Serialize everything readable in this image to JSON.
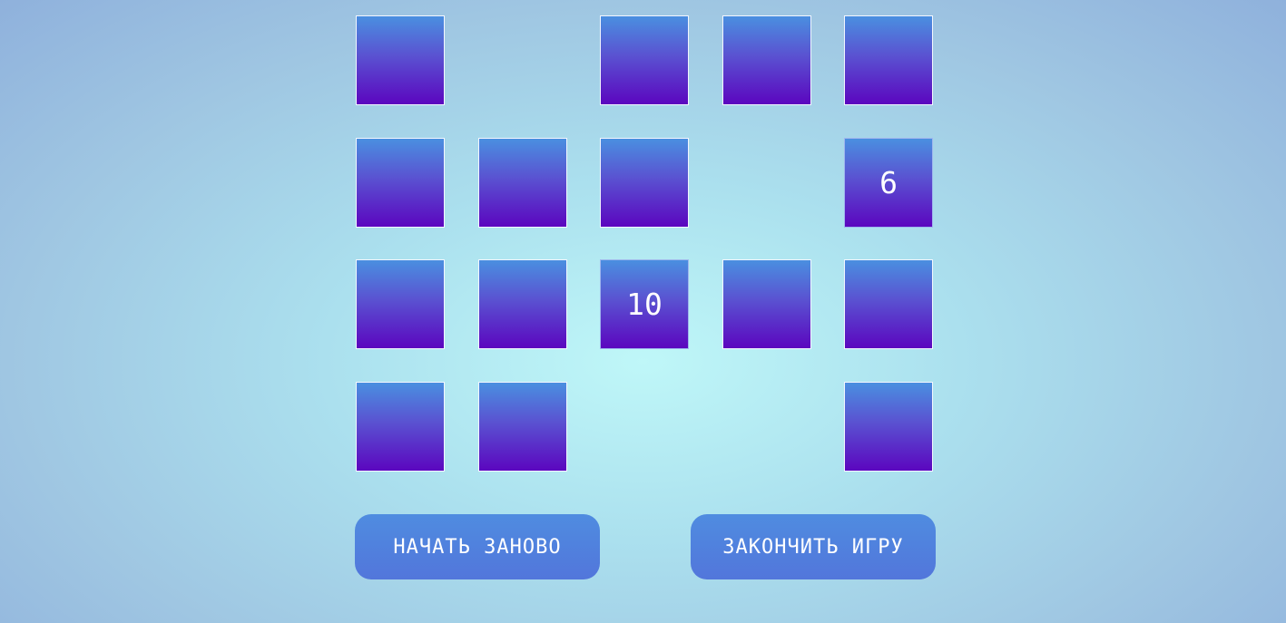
{
  "board": {
    "rows": [
      [
        {
          "state": "closed",
          "value": ""
        },
        {
          "state": "removed",
          "value": ""
        },
        {
          "state": "closed",
          "value": ""
        },
        {
          "state": "closed",
          "value": ""
        },
        {
          "state": "closed",
          "value": ""
        }
      ],
      [
        {
          "state": "closed",
          "value": ""
        },
        {
          "state": "closed",
          "value": ""
        },
        {
          "state": "closed",
          "value": ""
        },
        {
          "state": "removed",
          "value": ""
        },
        {
          "state": "open",
          "value": "6"
        }
      ],
      [
        {
          "state": "closed",
          "value": ""
        },
        {
          "state": "closed",
          "value": ""
        },
        {
          "state": "open",
          "value": "10"
        },
        {
          "state": "closed",
          "value": ""
        },
        {
          "state": "closed",
          "value": ""
        }
      ],
      [
        {
          "state": "closed",
          "value": ""
        },
        {
          "state": "closed",
          "value": ""
        },
        {
          "state": "removed",
          "value": ""
        },
        {
          "state": "removed",
          "value": ""
        },
        {
          "state": "closed",
          "value": ""
        }
      ]
    ]
  },
  "controls": {
    "restart_label": "НАЧАТЬ ЗАНОВО",
    "finish_label": "ЗАКОНЧИТЬ ИГРУ"
  },
  "colors": {
    "card_top": "#4a8fe0",
    "card_bottom": "#5b06bf",
    "button": "#5082de",
    "background_center": "#bff7f8",
    "background_edge": "#8fb1dc"
  }
}
